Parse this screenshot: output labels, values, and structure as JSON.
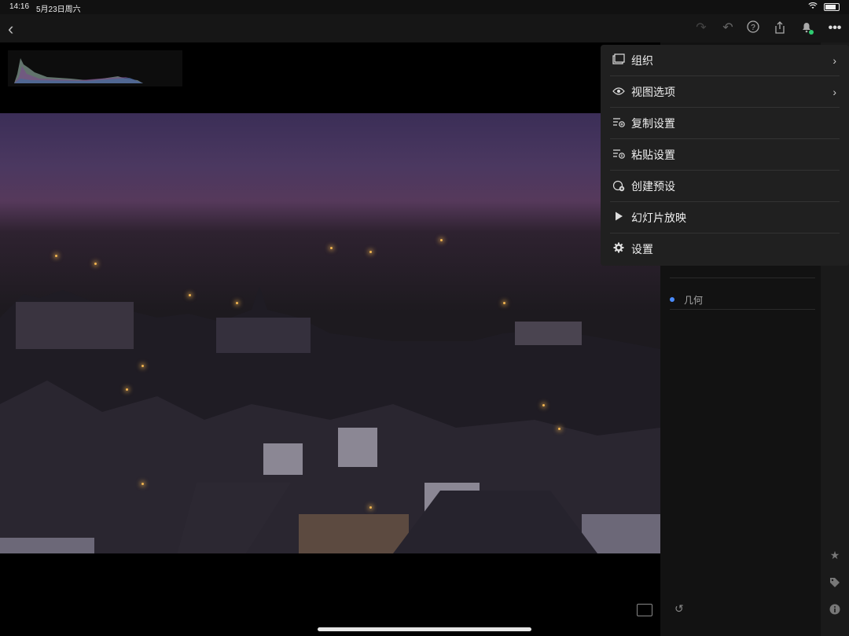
{
  "status_bar": {
    "time": "14:16",
    "date": "5月23日周六"
  },
  "toolbar": {
    "icons": [
      "redo-icon",
      "undo-icon",
      "help-icon",
      "share-icon",
      "notification-icon",
      "more-icon"
    ]
  },
  "menu": {
    "items": [
      {
        "label": "组织",
        "icon": "organize-icon",
        "has_submenu": true
      },
      {
        "label": "视图选项",
        "icon": "view-options-icon",
        "has_submenu": true
      },
      {
        "label": "复制设置",
        "icon": "copy-settings-icon",
        "has_submenu": false
      },
      {
        "label": "粘贴设置",
        "icon": "paste-settings-icon",
        "has_submenu": false
      },
      {
        "label": "创建预设",
        "icon": "create-preset-icon",
        "has_submenu": false
      },
      {
        "label": "幻灯片放映",
        "icon": "slideshow-icon",
        "has_submenu": false
      },
      {
        "label": "设置",
        "icon": "settings-icon",
        "has_submenu": false
      }
    ]
  },
  "right_panel": {
    "item_label": "几何"
  },
  "colors": {
    "accent": "#4a8cff",
    "notification": "#2ecc71"
  }
}
